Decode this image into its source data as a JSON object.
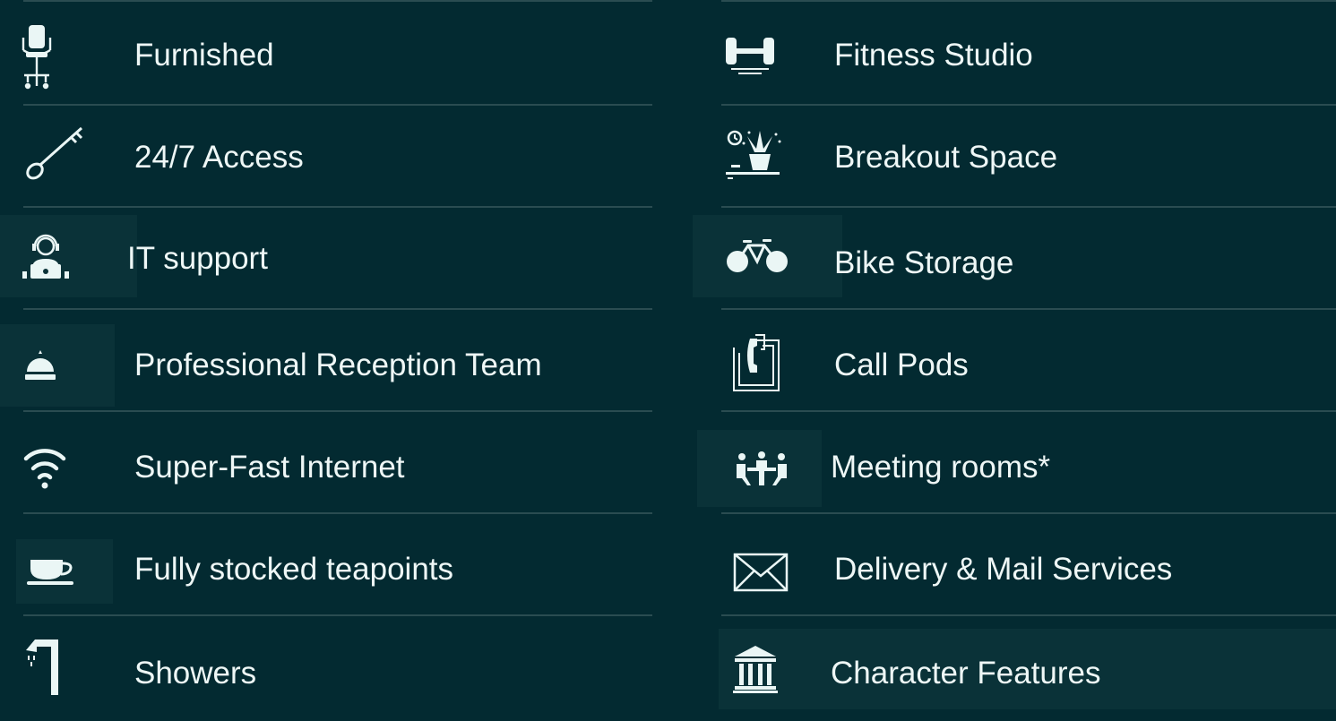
{
  "left_items": [
    {
      "label": "Furnished",
      "icon": "office-chair-icon"
    },
    {
      "label": "24/7 Access",
      "icon": "key-icon"
    },
    {
      "label": "IT support",
      "icon": "it-support-agent-icon"
    },
    {
      "label": "Professional Reception Team",
      "icon": "reception-bell-icon"
    },
    {
      "label": "Super-Fast Internet",
      "icon": "wifi-icon"
    },
    {
      "label": "Fully stocked teapoints",
      "icon": "teacup-icon"
    },
    {
      "label": "Showers",
      "icon": "shower-icon"
    }
  ],
  "right_items": [
    {
      "label": "Fitness Studio",
      "icon": "dumbbell-icon"
    },
    {
      "label": "Breakout Space",
      "icon": "plant-lounge-icon"
    },
    {
      "label": "Bike Storage",
      "icon": "bicycle-icon"
    },
    {
      "label": "Call Pods",
      "icon": "phone-booth-icon"
    },
    {
      "label": "Meeting rooms*",
      "icon": "meeting-table-icon"
    },
    {
      "label": "Delivery & Mail Services",
      "icon": "envelope-icon"
    },
    {
      "label": "Character Features",
      "icon": "heritage-building-icon"
    }
  ],
  "colors": {
    "background": "#032a31",
    "divider": "#2a4c51",
    "text": "#eef7f6"
  }
}
